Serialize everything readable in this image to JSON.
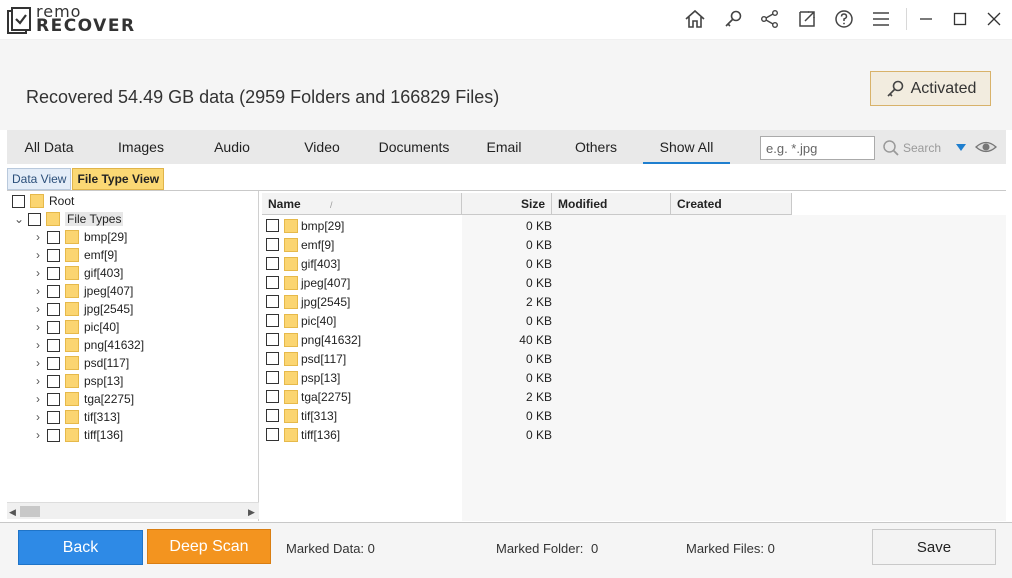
{
  "brand": {
    "line1": "remo",
    "line2": "RECOVER"
  },
  "window_controls": [
    "home-icon",
    "key-icon",
    "share-icon",
    "external-link-icon",
    "help-icon",
    "menu-icon",
    "minimize-icon",
    "maximize-icon",
    "close-icon"
  ],
  "header": {
    "recovered_text": "Recovered 54.49 GB data (2959 Folders and 166829 Files)",
    "activated_label": "Activated"
  },
  "tabs": [
    {
      "label": "All Data"
    },
    {
      "label": "Images"
    },
    {
      "label": "Audio"
    },
    {
      "label": "Video"
    },
    {
      "label": "Documents"
    },
    {
      "label": "Email"
    },
    {
      "label": "Others"
    },
    {
      "label": "Show All",
      "active": true
    }
  ],
  "filter": {
    "placeholder": "e.g. *.jpg",
    "search_label": "Search"
  },
  "view_tabs": [
    {
      "label": "Data View"
    },
    {
      "label": "File Type View",
      "active": true
    }
  ],
  "tree": {
    "root_label": "Root",
    "file_types_label": "File Types",
    "items": [
      "bmp[29]",
      "emf[9]",
      "gif[403]",
      "jpeg[407]",
      "jpg[2545]",
      "pic[40]",
      "png[41632]",
      "psd[117]",
      "psp[13]",
      "tga[2275]",
      "tif[313]",
      "tiff[136]"
    ]
  },
  "list": {
    "columns": {
      "name": "Name",
      "size": "Size",
      "modified": "Modified",
      "created": "Created"
    },
    "rows": [
      {
        "name": "bmp[29]",
        "size": "0 KB"
      },
      {
        "name": "emf[9]",
        "size": "0 KB"
      },
      {
        "name": "gif[403]",
        "size": "0 KB"
      },
      {
        "name": "jpeg[407]",
        "size": "0 KB"
      },
      {
        "name": "jpg[2545]",
        "size": "2 KB"
      },
      {
        "name": "pic[40]",
        "size": "0 KB"
      },
      {
        "name": "png[41632]",
        "size": "40 KB"
      },
      {
        "name": "psd[117]",
        "size": "0 KB"
      },
      {
        "name": "psp[13]",
        "size": "0 KB"
      },
      {
        "name": "tga[2275]",
        "size": "2 KB"
      },
      {
        "name": "tif[313]",
        "size": "0 KB"
      },
      {
        "name": "tiff[136]",
        "size": "0 KB"
      }
    ]
  },
  "bottom": {
    "back_label": "Back",
    "deep_scan_label": "Deep Scan",
    "marked_data_label": "Marked Data:",
    "marked_data_value": "0",
    "marked_folder_label": "Marked Folder:",
    "marked_folder_value": "0",
    "marked_files_label": "Marked Files:",
    "marked_files_value": "0",
    "save_label": "Save"
  },
  "colors": {
    "accent_blue": "#2e8ae6",
    "accent_orange": "#f3941f",
    "folder_yellow": "#fbd571",
    "active_tab_underline": "#1f7fcf"
  }
}
